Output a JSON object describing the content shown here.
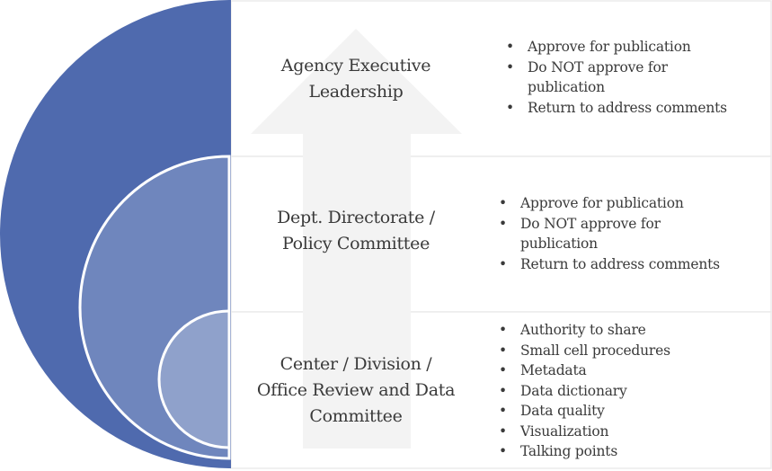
{
  "colors": {
    "outer": "#4f6aae",
    "middle": "#6f86bd",
    "inner": "#8fa1cb",
    "arrow": "#f3f3f3",
    "border": "#ececec"
  },
  "levels": [
    {
      "title_lines": [
        "Agency Executive",
        "Leadership"
      ],
      "bullets": [
        "Approve for publication",
        "Do NOT approve for publication",
        "Return to address comments"
      ]
    },
    {
      "title_lines": [
        "Dept. Directorate /",
        "Policy Committee"
      ],
      "bullets": [
        "Approve for publication",
        "Do NOT approve for publication",
        "Return to address comments"
      ]
    },
    {
      "title_lines": [
        "Center / Division /",
        "Office Review and Data",
        "Committee"
      ],
      "bullets": [
        "Authority to share",
        "Small cell procedures",
        "Metadata",
        "Data dictionary",
        "Data quality",
        "Visualization",
        "Talking points"
      ]
    }
  ],
  "arrow_icon": "arrow-up"
}
